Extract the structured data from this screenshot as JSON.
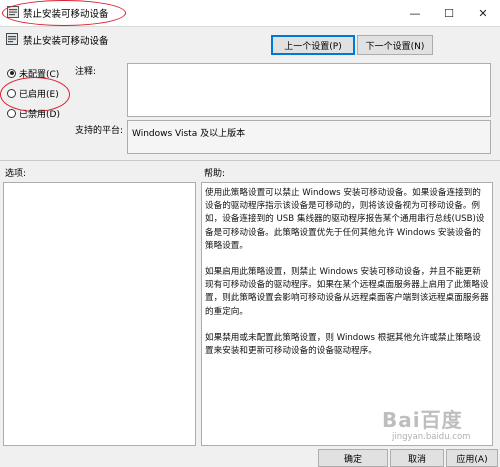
{
  "window": {
    "title": "禁止安装可移动设备",
    "minimize_glyph": "—",
    "maximize_glyph": "☐",
    "close_glyph": "✕"
  },
  "header": {
    "policy_name": "禁止安装可移动设备",
    "prev_button": "上一个设置(P)",
    "next_button": "下一个设置(N)"
  },
  "state": {
    "options": [
      {
        "label": "未配置(C)",
        "checked": true
      },
      {
        "label": "已启用(E)",
        "checked": false
      },
      {
        "label": "已禁用(D)",
        "checked": false
      }
    ]
  },
  "comment": {
    "label": "注释:",
    "value": ""
  },
  "supported": {
    "label": "支持的平台:",
    "value": "Windows Vista 及以上版本"
  },
  "options_section": {
    "label": "选项:"
  },
  "help_section": {
    "label": "帮助:",
    "paragraphs": [
      "使用此策略设置可以禁止 Windows 安装可移动设备。如果设备连接到的设备的驱动程序指示该设备是可移动的，则将该设备视为可移动设备。例如，设备连接到的 USB 集线器的驱动程序报告某个通用串行总线(USB)设备是可移动设备。此策略设置优先于任何其他允许 Windows 安装设备的策略设置。",
      "如果启用此策略设置，则禁止 Windows 安装可移动设备，并且不能更新现有可移动设备的驱动程序。如果在某个远程桌面服务器上启用了此策略设置，则此策略设置会影响可移动设备从远程桌面客户端到该远程桌面服务器的重定向。",
      "如果禁用或未配置此策略设置，则 Windows 根据其他允许或禁止策略设置来安装和更新可移动设备的设备驱动程序。"
    ]
  },
  "footer": {
    "ok_button": "确定",
    "cancel_button": "取消",
    "apply_button": "应用(A)"
  },
  "watermark": {
    "logo": "Bai百度",
    "sub": "jingyan.baidu.com"
  },
  "colors": {
    "annotation": "#d8202a",
    "accent": "#0078d7"
  }
}
